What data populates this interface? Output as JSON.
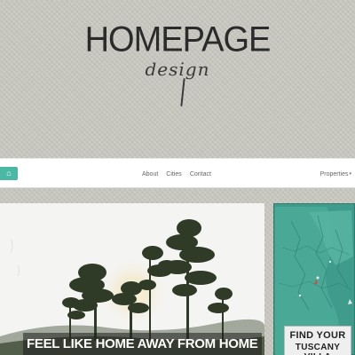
{
  "header": {
    "logo_title": "HOMEPAGE",
    "logo_subtitle": "design"
  },
  "navbar": {
    "brand_icon": "house-icon",
    "links": [
      {
        "label": "About"
      },
      {
        "label": "Cities"
      },
      {
        "label": "Contact"
      }
    ],
    "dropdown_label": "Properties",
    "dropdown_caret": "▾"
  },
  "hero": {
    "caption": "FEEL LIKE HOME AWAY FROM HOME"
  },
  "promo": {
    "line1": "FIND YOUR",
    "line2": "TUSCANY VILLA"
  },
  "colors": {
    "background": "#c9c8c1",
    "accent": "#4bb8a4",
    "map_sea": "#3e9e8e"
  }
}
